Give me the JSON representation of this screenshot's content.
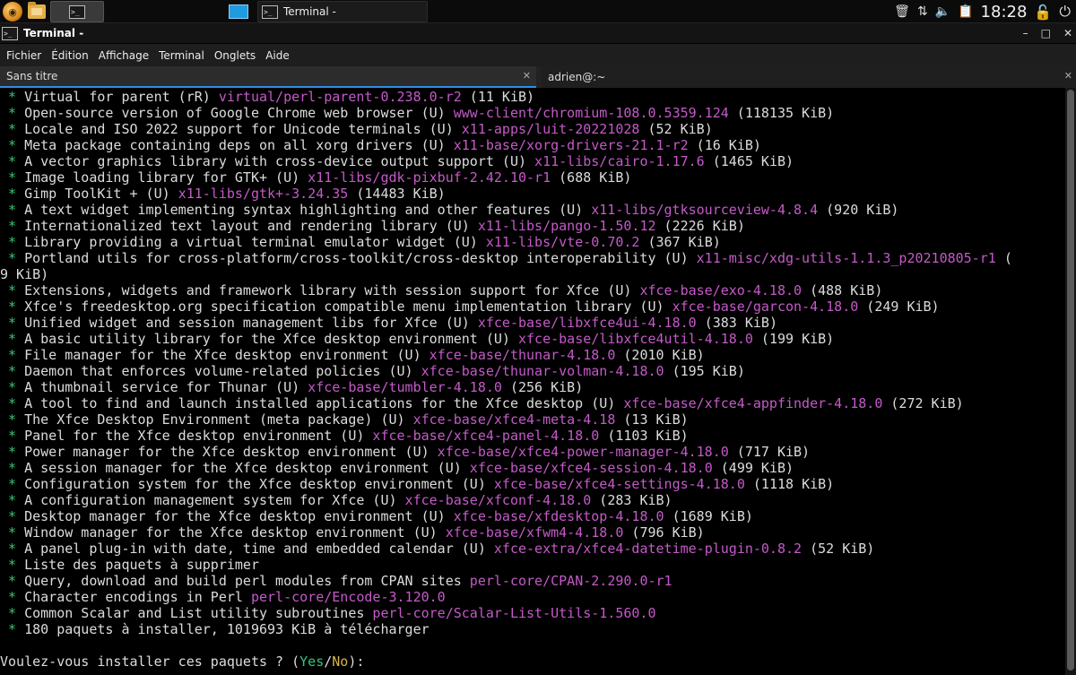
{
  "panel": {
    "apps_icon": "whisker-menu-icon",
    "files_icon": "folder-icon",
    "terminal_launcher_glyph": ">_",
    "taskbar_item_label": "Terminal -",
    "taskbar_item_glyph": ">_",
    "clock": "18:28",
    "tray_icons": [
      "trash-icon",
      "network-icon",
      "volume-icon",
      "clipboard-icon",
      "lock-icon",
      "exit-icon"
    ]
  },
  "window": {
    "title": "Terminal -",
    "title_glyph": ">_",
    "controls": {
      "minimize": "–",
      "maximize": "□",
      "close": "✕"
    }
  },
  "menubar": [
    "Fichier",
    "Édition",
    "Affichage",
    "Terminal",
    "Onglets",
    "Aide"
  ],
  "tabs": [
    {
      "label": "Sans titre",
      "close": "✕",
      "active": true
    },
    {
      "label": "adrien@:~",
      "close": "✕",
      "active": false
    }
  ],
  "colors": {
    "star": "#36c47b",
    "package": "#c45ac8",
    "yes": "#36c47b",
    "no": "#d8b24a",
    "tab_accent": "#2f8de4"
  },
  "terminal": {
    "lines": [
      {
        "prefix": " * ",
        "text": "Virtual for parent (rR) ",
        "pkg": "virtual/perl-parent-0.238.0-r2",
        "size": " (11 KiB)"
      },
      {
        "prefix": " * ",
        "text": "Open-source version of Google Chrome web browser (U) ",
        "pkg": "www-client/chromium-108.0.5359.124",
        "size": " (118135 KiB)"
      },
      {
        "prefix": " * ",
        "text": "Locale and ISO 2022 support for Unicode terminals (U) ",
        "pkg": "x11-apps/luit-20221028",
        "size": " (52 KiB)"
      },
      {
        "prefix": " * ",
        "text": "Meta package containing deps on all xorg drivers (U) ",
        "pkg": "x11-base/xorg-drivers-21.1-r2",
        "size": " (16 KiB)"
      },
      {
        "prefix": " * ",
        "text": "A vector graphics library with cross-device output support (U) ",
        "pkg": "x11-libs/cairo-1.17.6",
        "size": " (1465 KiB)"
      },
      {
        "prefix": " * ",
        "text": "Image loading library for GTK+ (U) ",
        "pkg": "x11-libs/gdk-pixbuf-2.42.10-r1",
        "size": " (688 KiB)"
      },
      {
        "prefix": " * ",
        "text": "Gimp ToolKit + (U) ",
        "pkg": "x11-libs/gtk+-3.24.35",
        "size": " (14483 KiB)"
      },
      {
        "prefix": " * ",
        "text": "A text widget implementing syntax highlighting and other features (U) ",
        "pkg": "x11-libs/gtksourceview-4.8.4",
        "size": " (920 KiB)"
      },
      {
        "prefix": " * ",
        "text": "Internationalized text layout and rendering library (U) ",
        "pkg": "x11-libs/pango-1.50.12",
        "size": " (2226 KiB)"
      },
      {
        "prefix": " * ",
        "text": "Library providing a virtual terminal emulator widget (U) ",
        "pkg": "x11-libs/vte-0.70.2",
        "size": " (367 KiB)"
      },
      {
        "prefix": " * ",
        "text": "Portland utils for cross-platform/cross-toolkit/cross-desktop interoperability (U) ",
        "pkg": "x11-misc/xdg-utils-1.1.3_p20210805-r1",
        "size": " ("
      },
      {
        "prefix": "",
        "text": "9 KiB)",
        "pkg": "",
        "size": ""
      },
      {
        "prefix": " * ",
        "text": "Extensions, widgets and framework library with session support for Xfce (U) ",
        "pkg": "xfce-base/exo-4.18.0",
        "size": " (488 KiB)"
      },
      {
        "prefix": " * ",
        "text": "Xfce's freedesktop.org specification compatible menu implementation library (U) ",
        "pkg": "xfce-base/garcon-4.18.0",
        "size": " (249 KiB)"
      },
      {
        "prefix": " * ",
        "text": "Unified widget and session management libs for Xfce (U) ",
        "pkg": "xfce-base/libxfce4ui-4.18.0",
        "size": " (383 KiB)"
      },
      {
        "prefix": " * ",
        "text": "A basic utility library for the Xfce desktop environment (U) ",
        "pkg": "xfce-base/libxfce4util-4.18.0",
        "size": " (199 KiB)"
      },
      {
        "prefix": " * ",
        "text": "File manager for the Xfce desktop environment (U) ",
        "pkg": "xfce-base/thunar-4.18.0",
        "size": " (2010 KiB)"
      },
      {
        "prefix": " * ",
        "text": "Daemon that enforces volume-related policies (U) ",
        "pkg": "xfce-base/thunar-volman-4.18.0",
        "size": " (195 KiB)"
      },
      {
        "prefix": " * ",
        "text": "A thumbnail service for Thunar (U) ",
        "pkg": "xfce-base/tumbler-4.18.0",
        "size": " (256 KiB)"
      },
      {
        "prefix": " * ",
        "text": "A tool to find and launch installed applications for the Xfce desktop (U) ",
        "pkg": "xfce-base/xfce4-appfinder-4.18.0",
        "size": " (272 KiB)"
      },
      {
        "prefix": " * ",
        "text": "The Xfce Desktop Environment (meta package) (U) ",
        "pkg": "xfce-base/xfce4-meta-4.18",
        "size": " (13 KiB)"
      },
      {
        "prefix": " * ",
        "text": "Panel for the Xfce desktop environment (U) ",
        "pkg": "xfce-base/xfce4-panel-4.18.0",
        "size": " (1103 KiB)"
      },
      {
        "prefix": " * ",
        "text": "Power manager for the Xfce desktop environment (U) ",
        "pkg": "xfce-base/xfce4-power-manager-4.18.0",
        "size": " (717 KiB)"
      },
      {
        "prefix": " * ",
        "text": "A session manager for the Xfce desktop environment (U) ",
        "pkg": "xfce-base/xfce4-session-4.18.0",
        "size": " (499 KiB)"
      },
      {
        "prefix": " * ",
        "text": "Configuration system for the Xfce desktop environment (U) ",
        "pkg": "xfce-base/xfce4-settings-4.18.0",
        "size": " (1118 KiB)"
      },
      {
        "prefix": " * ",
        "text": "A configuration management system for Xfce (U) ",
        "pkg": "xfce-base/xfconf-4.18.0",
        "size": " (283 KiB)"
      },
      {
        "prefix": " * ",
        "text": "Desktop manager for the Xfce desktop environment (U) ",
        "pkg": "xfce-base/xfdesktop-4.18.0",
        "size": " (1689 KiB)"
      },
      {
        "prefix": " * ",
        "text": "Window manager for the Xfce desktop environment (U) ",
        "pkg": "xfce-base/xfwm4-4.18.0",
        "size": " (796 KiB)"
      },
      {
        "prefix": " * ",
        "text": "A panel plug-in with date, time and embedded calendar (U) ",
        "pkg": "xfce-extra/xfce4-datetime-plugin-0.8.2",
        "size": " (52 KiB)"
      },
      {
        "prefix": " * ",
        "text": "Liste des paquets à supprimer",
        "pkg": "",
        "size": ""
      },
      {
        "prefix": " * ",
        "text": "Query, download and build perl modules from CPAN sites ",
        "pkg": "perl-core/CPAN-2.290.0-r1",
        "size": ""
      },
      {
        "prefix": " * ",
        "text": "Character encodings in Perl ",
        "pkg": "perl-core/Encode-3.120.0",
        "size": ""
      },
      {
        "prefix": " * ",
        "text": "Common Scalar and List utility subroutines ",
        "pkg": "perl-core/Scalar-List-Utils-1.560.0",
        "size": ""
      },
      {
        "prefix": " * ",
        "text": "180 paquets à installer, 1019693 KiB à télécharger",
        "pkg": "",
        "size": ""
      },
      {
        "prefix": "",
        "text": "",
        "pkg": "",
        "size": ""
      }
    ],
    "prompt": {
      "question": "Voulez-vous installer ces paquets ? (",
      "yes": "Yes",
      "sep": "/",
      "no": "No",
      "end": "):"
    }
  }
}
